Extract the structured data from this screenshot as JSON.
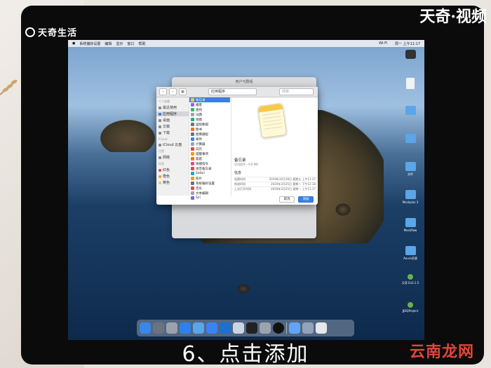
{
  "watermark_tl": "天奇生活",
  "watermark_tr": "天奇·视频",
  "watermark_br": "云南龙网",
  "caption": "6、点击添加",
  "menubar": {
    "items": [
      "",
      "系统偏好设置",
      "编辑",
      "显示",
      "窗口",
      "帮助"
    ],
    "status": [
      "Wi-Fi",
      "周一 上午11:17"
    ]
  },
  "dialog": {
    "window_title": "用户与群组",
    "location": "应用程序",
    "search_placeholder": "搜索",
    "sidebar": {
      "sections": [
        {
          "title": "个人收藏",
          "items": [
            "最近使用",
            "应用程序",
            "桌面",
            "文稿",
            "下载"
          ]
        },
        {
          "title": "iCloud",
          "items": [
            "iCloud 云盘"
          ]
        },
        {
          "title": "位置",
          "items": [
            "网络"
          ]
        },
        {
          "title": "标签",
          "items": [
            "红色",
            "橙色",
            "黄色"
          ]
        }
      ]
    },
    "apps": [
      "备忘录",
      "播客",
      "查找",
      "词典",
      "地图",
      "国际象棋",
      "图书",
      "图像捕捉",
      "邮件",
      "计算器",
      "日历",
      "提醒事项",
      "家庭",
      "快捷指令",
      "语音备忘录",
      "Safari",
      "照片",
      "系统偏好设置",
      "音乐",
      "文本编辑",
      "Siri"
    ],
    "selected_app": "备忘录",
    "preview": {
      "name": "备忘录",
      "subtitle": "应用程序 - 9.8 MB",
      "info_header": "信息",
      "rows": [
        {
          "label": "创建时间",
          "value": "2019年10月18日 星期五 上午11:37"
        },
        {
          "label": "修改时间",
          "value": "2020年3月25日 星期一 下午12:18"
        },
        {
          "label": "上次打开时间",
          "value": "2020年3月25日 星期一 上午11:17"
        }
      ]
    },
    "cancel_label": "取消",
    "add_label": "添加"
  },
  "desktop_items": [
    {
      "label": "",
      "kind": "app"
    },
    {
      "label": "",
      "kind": "file"
    },
    {
      "label": "",
      "kind": "folder"
    },
    {
      "label": "",
      "kind": "folder"
    },
    {
      "label": "文件",
      "kind": "folder"
    },
    {
      "label": "Mockplus 3",
      "kind": "folder"
    },
    {
      "label": "Mockflow",
      "kind": "folder"
    },
    {
      "label": "Axure资源",
      "kind": "folder"
    },
    {
      "label": "天奇 Ex3.1.5",
      "kind": "link"
    },
    {
      "label": "JJDQProject",
      "kind": "link"
    }
  ],
  "dock_colors": [
    "#3a86e8",
    "#6b7280",
    "#9aa3ad",
    "#2f80ed",
    "#5aa6e8",
    "#3b82f6",
    "#1f6fd1",
    "#cbd5e1",
    "#222222",
    "#9ca3af",
    "#111111",
    "#60a5fa",
    "#94a3b8",
    "#e5e7eb"
  ]
}
